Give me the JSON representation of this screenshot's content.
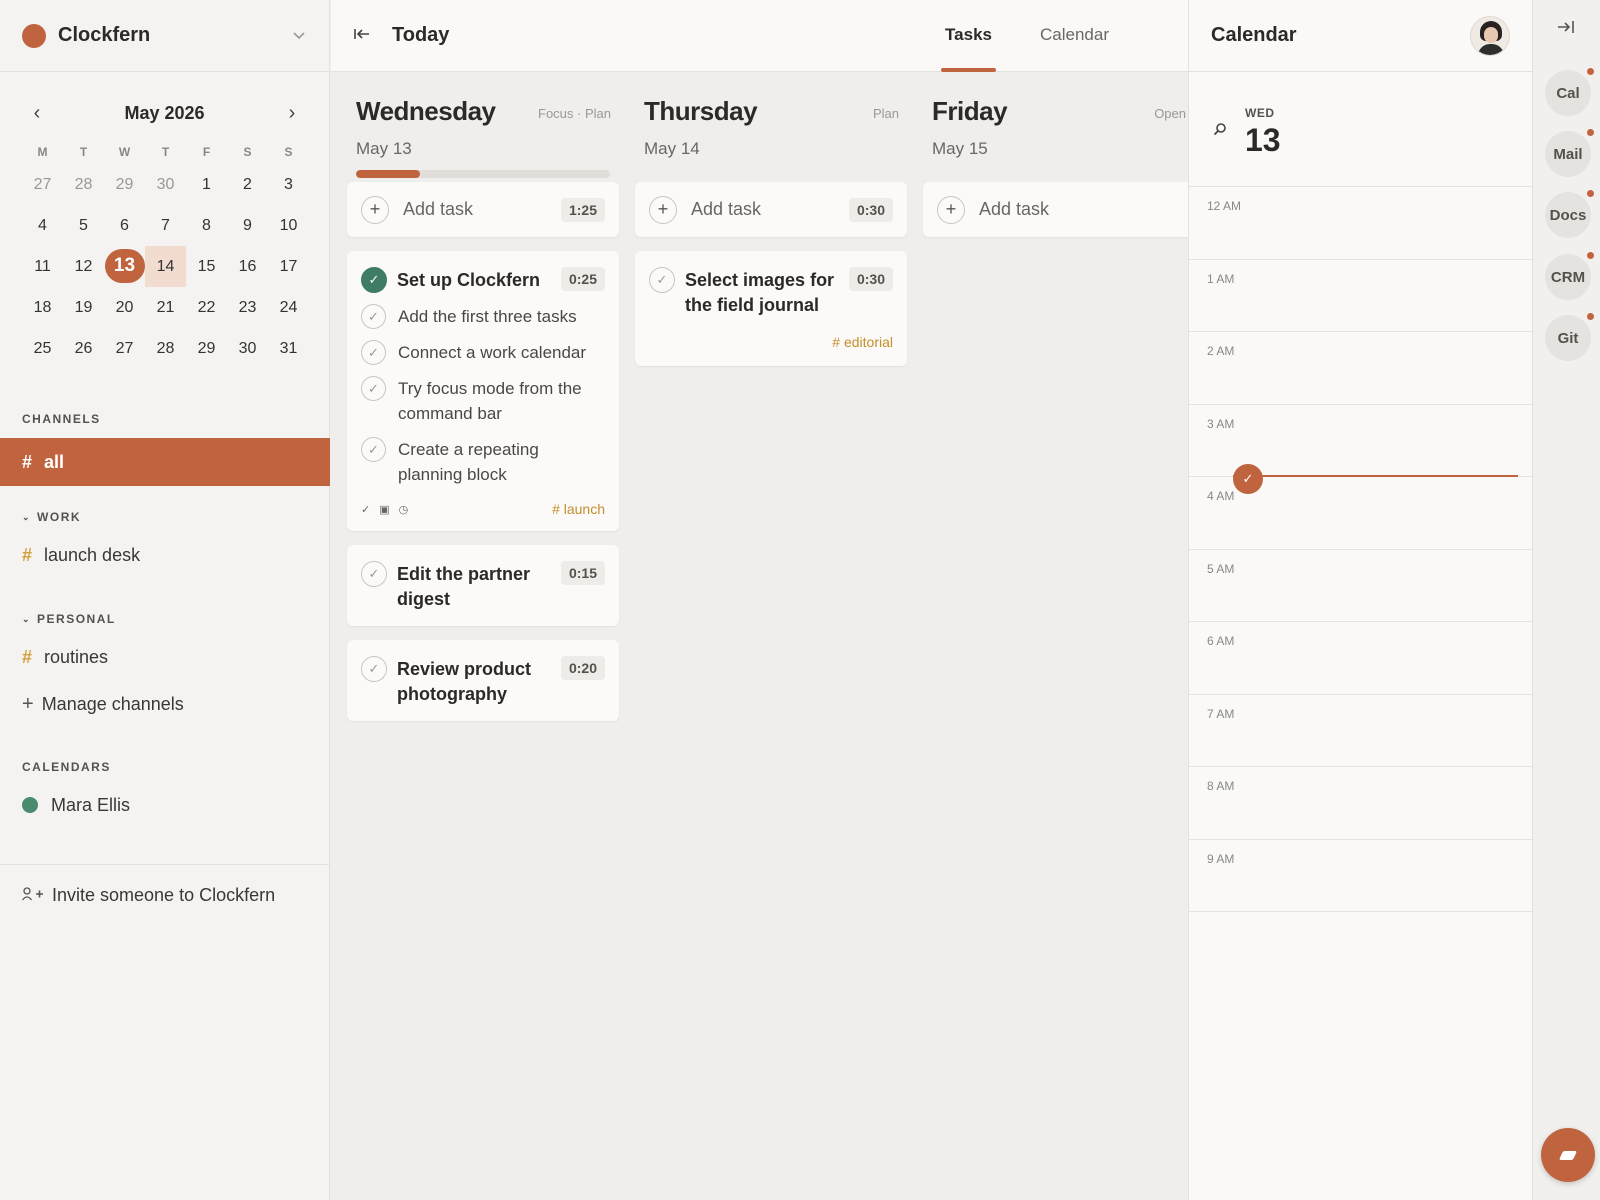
{
  "workspace": {
    "name": "Clockfern"
  },
  "mini_calendar": {
    "title": "May 2026",
    "prev": "‹",
    "next": "›",
    "dow": [
      "M",
      "T",
      "W",
      "T",
      "F",
      "S",
      "S"
    ],
    "weeks": [
      [
        "27",
        "28",
        "29",
        "30",
        "1",
        "2",
        "3"
      ],
      [
        "4",
        "5",
        "6",
        "7",
        "8",
        "9",
        "10"
      ],
      [
        "11",
        "12",
        "13",
        "14",
        "15",
        "16",
        "17"
      ],
      [
        "18",
        "19",
        "20",
        "21",
        "22",
        "23",
        "24"
      ],
      [
        "25",
        "26",
        "27",
        "28",
        "29",
        "30",
        "31"
      ]
    ],
    "today": "13",
    "selected": "14"
  },
  "sidebar": {
    "channels_label": "CHANNELS",
    "channel_all": "all",
    "groups": [
      {
        "label": "WORK",
        "channel": "launch desk"
      },
      {
        "label": "PERSONAL",
        "channel": "routines"
      }
    ],
    "manage_label": "Manage channels",
    "calendars_label": "CALENDARS",
    "calendar_name": "Mara Ellis",
    "invite_label": "Invite someone to Clockfern"
  },
  "topbar": {
    "title": "Today",
    "tabs": [
      {
        "label": "Tasks"
      },
      {
        "label": "Calendar"
      }
    ]
  },
  "columns": [
    {
      "day": "Wednesday",
      "date": "May 13",
      "meta": "Focus · Plan",
      "progress": 0.25,
      "add_label": "Add task",
      "add_time": "1:25",
      "tasks": [
        {
          "title": "Set up Clockfern",
          "time": "0:25",
          "done": true,
          "subtasks": [
            "Add the first three tasks",
            "Connect a work calendar",
            "Try focus mode from the command bar",
            "Create a repeating planning block"
          ],
          "tag": "# launch"
        },
        {
          "title": "Edit the partner digest",
          "time": "0:15"
        },
        {
          "title": "Review product photography",
          "time": "0:20"
        }
      ]
    },
    {
      "day": "Thursday",
      "date": "May 14",
      "meta": "Plan",
      "add_label": "Add task",
      "add_time": "0:30",
      "tasks": [
        {
          "title": "Select images for the field journal",
          "time": "0:30",
          "tag": "# editorial"
        }
      ]
    },
    {
      "day": "Friday",
      "date": "May 15",
      "meta": "Open",
      "add_label": "Add task"
    }
  ],
  "right_calendar": {
    "title": "Calendar",
    "dow": "WED",
    "day_num": "13",
    "hours": [
      "12 AM",
      "1 AM",
      "2 AM",
      "3 AM",
      "4 AM",
      "5 AM",
      "6 AM",
      "7 AM",
      "8 AM",
      "9 AM"
    ]
  },
  "rail": {
    "apps": [
      "Cal",
      "Mail",
      "Docs",
      "CRM",
      "Git"
    ]
  },
  "colors": {
    "accent": "#c0643f",
    "done": "#3e7c66",
    "tag": "#c38f2b",
    "calendar_dot": "#4a8a6f"
  }
}
